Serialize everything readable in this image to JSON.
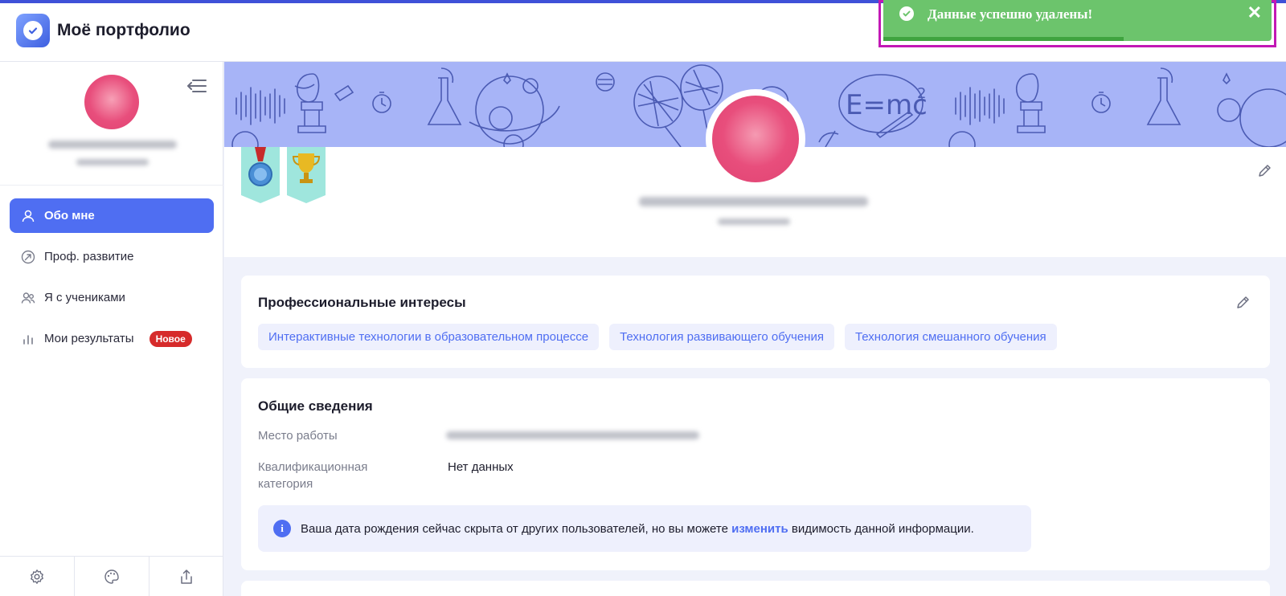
{
  "app": {
    "title": "Моё портфолио"
  },
  "toast": {
    "message": "Данные успешно удалены!",
    "close": "✕",
    "progress": 0.62
  },
  "sidebar": {
    "items": [
      {
        "label": "Обо мне",
        "icon": "user-icon",
        "active": true
      },
      {
        "label": "Проф. развитие",
        "icon": "growth-icon",
        "active": false
      },
      {
        "label": "Я с учениками",
        "icon": "students-icon",
        "active": false
      },
      {
        "label": "Мои результаты",
        "icon": "chart-icon",
        "active": false,
        "badge": "Новое"
      }
    ],
    "bottom": [
      "settings-icon",
      "palette-icon",
      "share-icon"
    ]
  },
  "interests": {
    "title": "Профессиональные интересы",
    "chips": [
      "Интерактивные технологии в образовательном процессе",
      "Технология развивающего обучения",
      "Технология смешанного обучения"
    ]
  },
  "general": {
    "title": "Общие сведения",
    "workplace_label": "Место работы",
    "qualification_label_1": "Квалификационная",
    "qualification_label_2": "категория",
    "qualification_value": "Нет данных",
    "info_before": "Ваша дата рождения сейчас скрыта от других пользователей, но вы можете",
    "info_link": "изменить",
    "info_after": "видимость данной информации."
  },
  "colors": {
    "accent": "#4f6ef2",
    "toast": "#6cc46c",
    "badge": "#d62b2b",
    "banner": "#a7b4f7"
  }
}
